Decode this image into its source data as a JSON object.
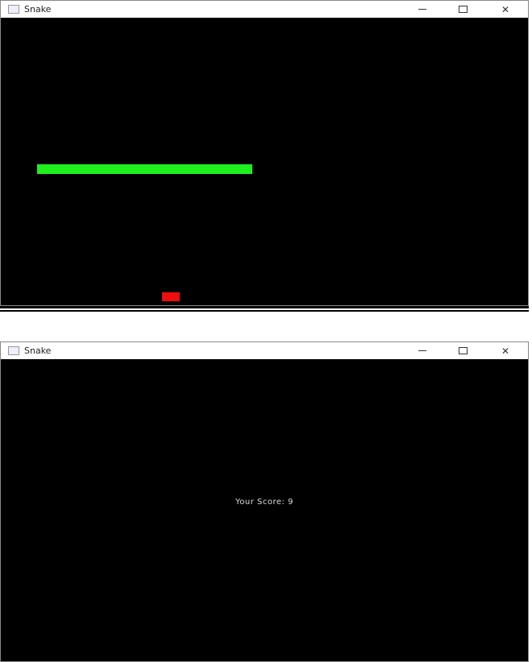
{
  "windows": [
    {
      "title": "Snake",
      "controls": {
        "minimize": "minimize",
        "maximize": "maximize",
        "close": "close"
      }
    },
    {
      "title": "Snake",
      "score_text": "Your Score: 9"
    }
  ],
  "colors": {
    "snake": "#1ef01e",
    "food": "#f00d0d",
    "background": "#000000"
  }
}
